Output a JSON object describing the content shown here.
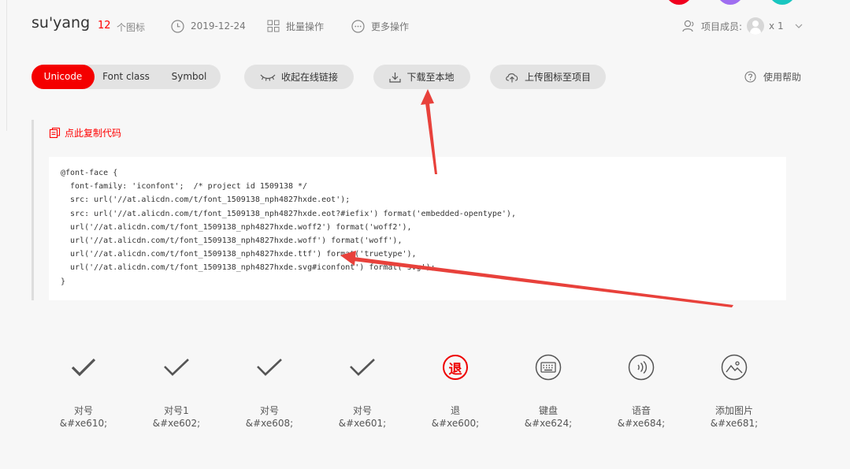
{
  "header": {
    "project_name": "su'yang",
    "icon_count": "12",
    "icon_count_label": "个图标",
    "date": "2019-12-24",
    "batch_label": "批量操作",
    "more_label": "更多操作",
    "members_label": "项目成员:",
    "members_count": "x 1"
  },
  "toolbar": {
    "tabs": [
      {
        "label": "Unicode",
        "active": true
      },
      {
        "label": "Font class",
        "active": false
      },
      {
        "label": "Symbol",
        "active": false
      }
    ],
    "collapse_link_label": "收起在线链接",
    "download_label": "下载至本地",
    "upload_label": "上传图标至项目",
    "help_label": "使用帮助"
  },
  "code": {
    "copy_label": "点此复制代码",
    "text": "@font-face {\n  font-family: 'iconfont';  /* project id 1509138 */\n  src: url('//at.alicdn.com/t/font_1509138_nph4827hxde.eot');\n  src: url('//at.alicdn.com/t/font_1509138_nph4827hxde.eot?#iefix') format('embedded-opentype'),\n  url('//at.alicdn.com/t/font_1509138_nph4827hxde.woff2') format('woff2'),\n  url('//at.alicdn.com/t/font_1509138_nph4827hxde.woff') format('woff'),\n  url('//at.alicdn.com/t/font_1509138_nph4827hxde.ttf') format('truetype'),\n  url('//at.alicdn.com/t/font_1509138_nph4827hxde.svg#iconfont') format('svg');\n}"
  },
  "icons": [
    {
      "name": "对号",
      "code": "&#xe610;",
      "icon": "check-icon"
    },
    {
      "name": "对号1",
      "code": "&#xe602;",
      "icon": "check-icon"
    },
    {
      "name": "对号",
      "code": "&#xe608;",
      "icon": "check-icon"
    },
    {
      "name": "对号",
      "code": "&#xe601;",
      "icon": "check-icon"
    },
    {
      "name": "退",
      "code": "&#xe600;",
      "icon": "return-character-icon",
      "glyph": "退"
    },
    {
      "name": "键盘",
      "code": "&#xe624;",
      "icon": "keyboard-icon"
    },
    {
      "name": "语音",
      "code": "&#xe684;",
      "icon": "voice-icon"
    },
    {
      "name": "添加图片",
      "code": "&#xe681;",
      "icon": "add-image-icon"
    }
  ],
  "colors": {
    "accent": "#f40000",
    "annotation_arrow": "#e8413b",
    "page_bg": "#f7f7f7"
  }
}
